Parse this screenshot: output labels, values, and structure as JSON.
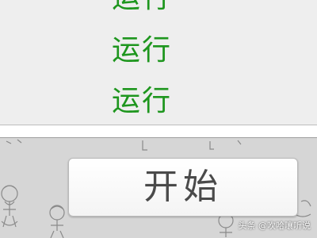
{
  "run_list": {
    "items": [
      {
        "label": "运行"
      },
      {
        "label": "运行"
      },
      {
        "label": "运行"
      }
    ],
    "label_color": "#1e961e"
  },
  "start_button": {
    "label": "开始"
  },
  "watermark": {
    "text": "头条 @吹哈嚷听说"
  }
}
